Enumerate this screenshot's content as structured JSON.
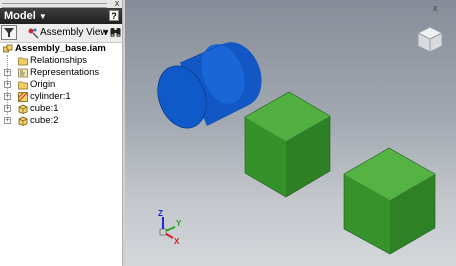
{
  "browser": {
    "title": "Model",
    "help_label": "?",
    "close_label": "x",
    "view_selector": "Assembly View",
    "tree": [
      {
        "label": "Assembly_base.iam",
        "kind": "assembly",
        "bold": true
      },
      {
        "label": "Relationships",
        "kind": "folder"
      },
      {
        "label": "Representations",
        "kind": "representations",
        "expandable": true
      },
      {
        "label": "Origin",
        "kind": "folder",
        "expandable": true
      },
      {
        "label": "cylinder:1",
        "kind": "part-constrained",
        "expandable": true
      },
      {
        "label": "cube:1",
        "kind": "part",
        "expandable": true
      },
      {
        "label": "cube:2",
        "kind": "part",
        "expandable": true
      }
    ]
  },
  "viewport": {
    "close_label": "x",
    "triad_labels": {
      "x": "X",
      "y": "Y",
      "z": "Z"
    }
  },
  "colors": {
    "cylinder": "#1160cf",
    "cube": "#3b9a2b",
    "header": "#2d2d2d",
    "x_axis": "#d62020",
    "y_axis": "#1fa81f",
    "z_axis": "#1a2ccf"
  }
}
